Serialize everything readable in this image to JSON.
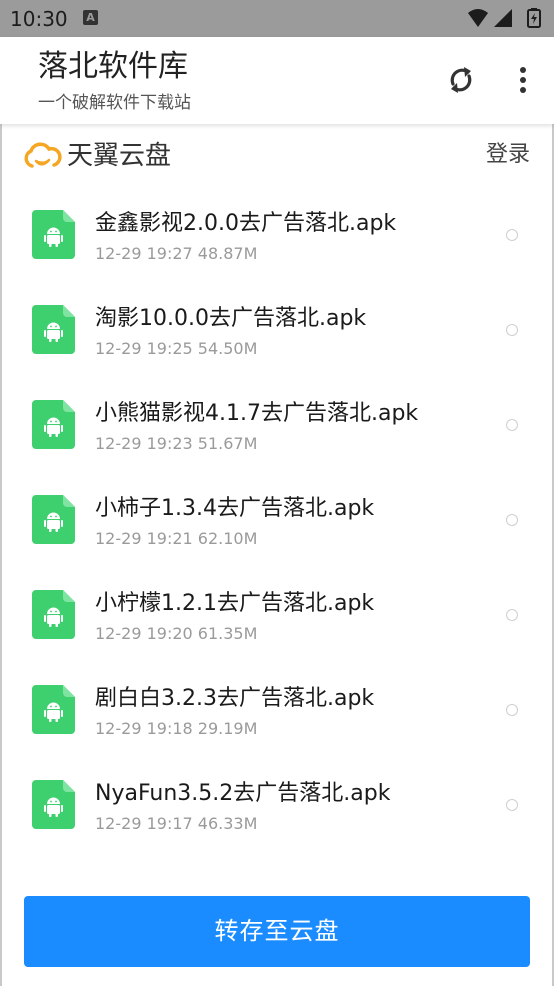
{
  "status_bar": {
    "time": "10:30",
    "notification_icon": "A"
  },
  "app_bar": {
    "title": "落北软件库",
    "subtitle": "一个破解软件下载站"
  },
  "cloud": {
    "provider_name": "天翼云盘",
    "login_label": "登录",
    "logo_color": "#f5a623"
  },
  "files": [
    {
      "name": "金鑫影视2.0.0去广告落北.apk",
      "meta": "12-29 19:27 48.87M"
    },
    {
      "name": "淘影10.0.0去广告落北.apk",
      "meta": "12-29 19:25 54.50M"
    },
    {
      "name": "小熊猫影视4.1.7去广告落北.apk",
      "meta": "12-29 19:23 51.67M"
    },
    {
      "name": "小柿子1.3.4去广告落北.apk",
      "meta": "12-29 19:21 62.10M"
    },
    {
      "name": "小柠檬1.2.1去广告落北.apk",
      "meta": "12-29 19:20 61.35M"
    },
    {
      "name": "剧白白3.2.3去广告落北.apk",
      "meta": "12-29 19:18 29.19M"
    },
    {
      "name": "NyaFun3.5.2去广告落北.apk",
      "meta": "12-29 19:17 46.33M"
    }
  ],
  "actions": {
    "save_to_cloud": "转存至云盘"
  },
  "colors": {
    "primary": "#1b8cff",
    "apk_icon": "#3ecf6e",
    "status_bar": "#9b9b9b"
  },
  "icons": {
    "refresh": "refresh-icon",
    "more": "more-vert-icon",
    "apk": "android-apk-icon",
    "wifi": "wifi-icon",
    "signal": "signal-icon",
    "battery": "battery-icon"
  }
}
